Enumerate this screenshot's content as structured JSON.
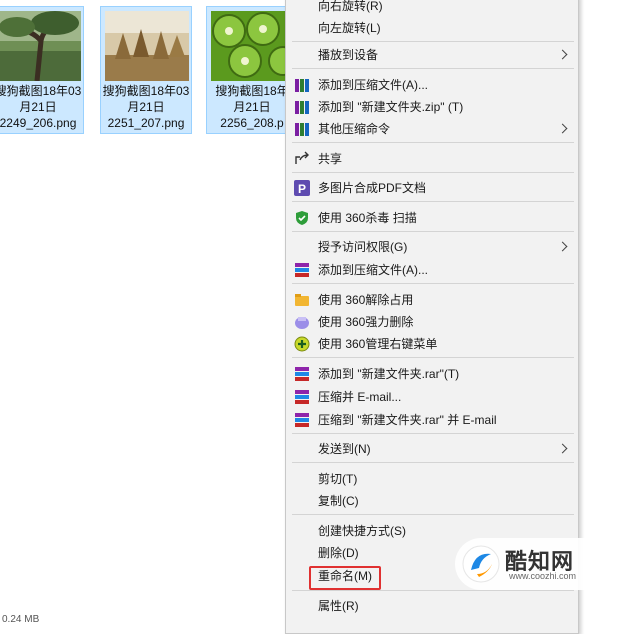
{
  "files": [
    {
      "line1": "搜狗截图18年03",
      "line2": "月21日",
      "line3": "2249_206.png",
      "scene": "forest-tree"
    },
    {
      "line1": "搜狗截图18年03",
      "line2": "月21日",
      "line3": "2251_207.png",
      "scene": "haystacks"
    },
    {
      "line1": "搜狗截图18年",
      "line2": "月21日",
      "line3": "2256_208.p",
      "scene": "kiwi"
    }
  ],
  "status_partial": "0.24 MB",
  "menu": {
    "items": [
      {
        "label": "向右旋转(R)",
        "icon": "",
        "submenu": false
      },
      {
        "label": "向左旋转(L)",
        "icon": "",
        "submenu": false
      },
      {
        "label": "播放到设备",
        "icon": "",
        "submenu": true
      },
      {
        "label": "添加到压缩文件(A)...",
        "icon": "winrar-books-icon",
        "submenu": false
      },
      {
        "label": "添加到 \"新建文件夹.zip\" (T)",
        "icon": "winrar-books-icon",
        "submenu": false
      },
      {
        "label": "其他压缩命令",
        "icon": "winrar-books-icon",
        "submenu": true
      },
      {
        "label": "共享",
        "icon": "share-icon",
        "submenu": false
      },
      {
        "label": "多图片合成PDF文档",
        "icon": "pdf-p-icon",
        "submenu": false
      },
      {
        "label": "使用 360杀毒 扫描",
        "icon": "shield-icon",
        "submenu": false
      },
      {
        "label": "授予访问权限(G)",
        "icon": "",
        "submenu": true
      },
      {
        "label": "添加到压缩文件(A)...",
        "icon": "rar-stack-icon",
        "submenu": false
      },
      {
        "label": "使用 360解除占用",
        "icon": "unlock-folder-icon",
        "submenu": false
      },
      {
        "label": "使用 360强力删除",
        "icon": "shred-icon",
        "submenu": false
      },
      {
        "label": "使用 360管理右键菜单",
        "icon": "plus-menu-icon",
        "submenu": false
      },
      {
        "label": "添加到 \"新建文件夹.rar\"(T)",
        "icon": "rar-stack-icon",
        "submenu": false
      },
      {
        "label": "压缩并 E-mail...",
        "icon": "rar-stack-icon",
        "submenu": false
      },
      {
        "label": "压缩到 \"新建文件夹.rar\" 并 E-mail",
        "icon": "rar-stack-icon",
        "submenu": false
      },
      {
        "label": "发送到(N)",
        "icon": "",
        "submenu": true
      },
      {
        "label": "剪切(T)",
        "icon": "",
        "submenu": false
      },
      {
        "label": "复制(C)",
        "icon": "",
        "submenu": false
      },
      {
        "label": "创建快捷方式(S)",
        "icon": "",
        "submenu": false
      },
      {
        "label": "删除(D)",
        "icon": "",
        "submenu": false
      },
      {
        "label": "重命名(M)",
        "icon": "",
        "submenu": false
      },
      {
        "label": "属性(R)",
        "icon": "",
        "submenu": false
      }
    ]
  },
  "highlight_color": "#e03131",
  "watermark": {
    "name": "酷知网",
    "url": "www.coozhi.com"
  }
}
